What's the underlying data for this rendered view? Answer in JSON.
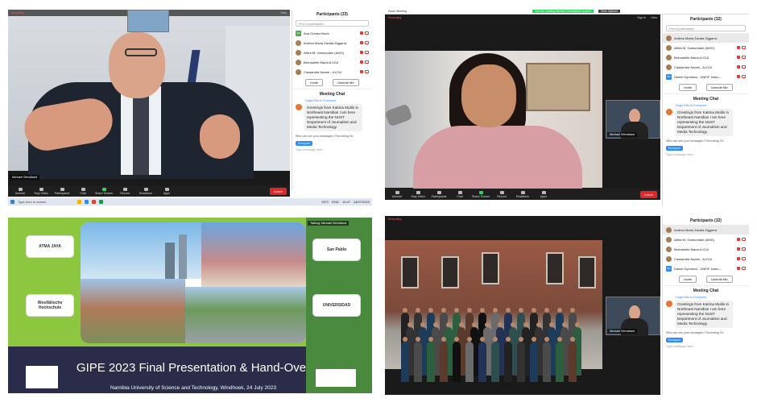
{
  "participants_panel": {
    "title_q1": "Participants (33)",
    "title_q2": "Participants (32)",
    "title_q4": "Participants (32)",
    "search_placeholder": "Find a participant",
    "items_q1": [
      "Ana Gomez Burto",
      "Andrea Maria Zavala Ziggarra",
      "Alfies M. Gamundani (AMG)",
      "Bernadette Maria A.ICUI",
      "Cassandra Naomi - A.ICUI"
    ],
    "items_q24": [
      "Andrea Maria Zavala Ziggarra",
      "Alfies M. Gamundani (AMG)",
      "Bernadette Maria A.ICUI",
      "Cassandra Naomi - A.ICUI",
      "Daniel Dyonisus - UNEIF Indon..."
    ],
    "invite": "Invite",
    "unmute_me": "Unmute Me"
  },
  "chat": {
    "title": "Meeting Chat",
    "from": "Hugh Ellis to Everyone",
    "message": "Greetings from Katima Mulilo in Northeast Namibia! I am here representing the NUST Department of Journalism and Media Technology.",
    "who_can_see": "Who can see your messages? Recording On",
    "to": "Everyone",
    "type_here": "Type message here..."
  },
  "toolbar": {
    "items": [
      "Unmute",
      "Stop Video",
      "Participants",
      "Chat",
      "Share Screen",
      "Record",
      "Reactions",
      "Apps"
    ],
    "leave": "Leave"
  },
  "taskbar": {
    "search": "Type here to search",
    "weather": "24°C",
    "lang": "ENG",
    "time": "19:47",
    "date": "24/07/2023"
  },
  "names": {
    "michael": "Michael Wendland",
    "recording": "Recording",
    "zoom_title": "Zoom Meeting",
    "viewing_banner": "You are viewing Michael Wendland's screen",
    "view_options": "View Options",
    "talking": "Talking: Michael Wendland",
    "signin": "Sign in",
    "view": "View"
  },
  "slide": {
    "title": "GIPE 2023 Final Presentation & Hand-Over",
    "subtitle": "Namibia University of Science and Technology, Windhoek, 24 July 2023",
    "logo_left_1": "ATMA JAYA",
    "logo_left_2": "Westfälische Hochschule",
    "logo_right_1": "San Pablo",
    "logo_right_2": "UNIVERSIDAD"
  }
}
